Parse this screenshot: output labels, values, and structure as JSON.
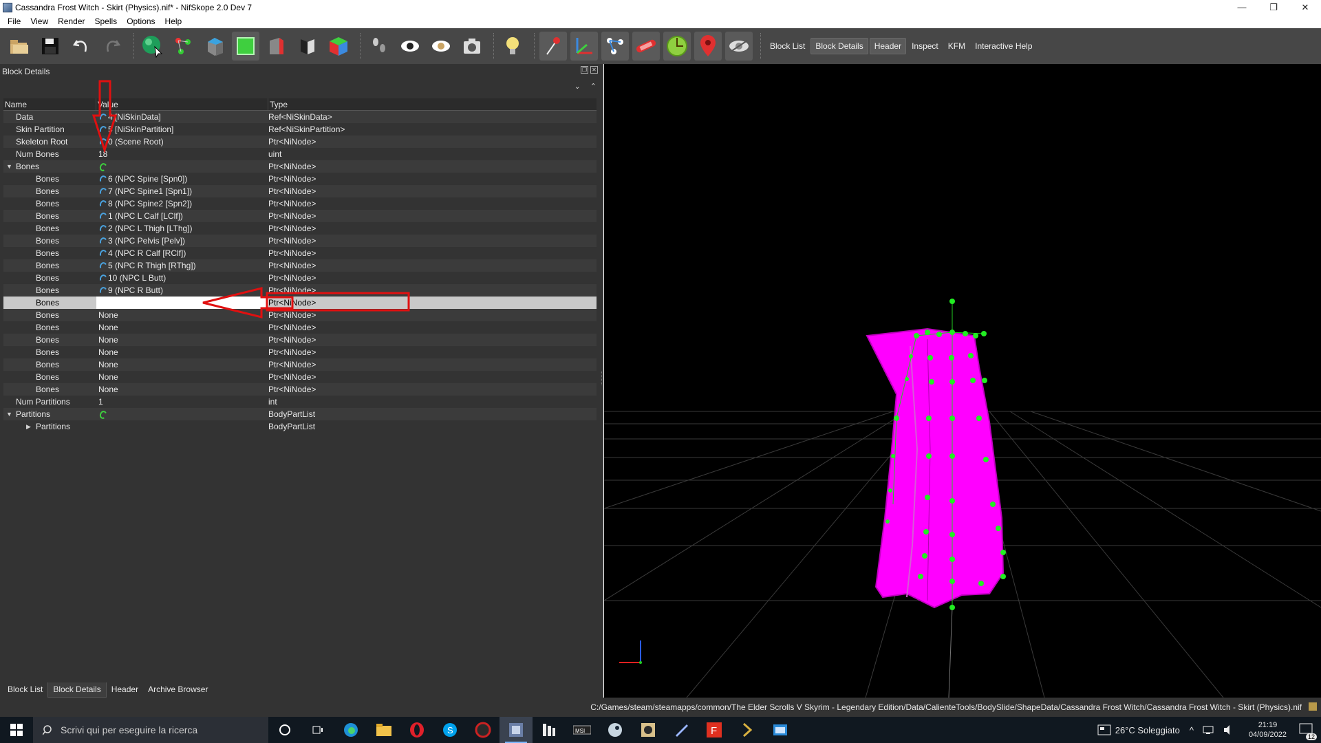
{
  "window": {
    "title": "Cassandra Frost Witch - Skirt (Physics).nif* - NifSkope 2.0 Dev 7",
    "minimize": "—",
    "maximize": "❐",
    "close": "✕"
  },
  "menu": [
    "File",
    "View",
    "Render",
    "Spells",
    "Options",
    "Help"
  ],
  "toolbar": {
    "text_buttons": [
      "Block List",
      "Block Details",
      "Header",
      "Inspect",
      "KFM",
      "Interactive Help"
    ],
    "active_text_button": "Block Details"
  },
  "block_details": {
    "title": "Block Details",
    "columns": [
      "Name",
      "Value",
      "Type"
    ],
    "rows": [
      {
        "name": "Data",
        "value": "4 [NiSkinData]",
        "type": "Ref<NiSkinData>",
        "icon": "link-icon",
        "indent": 1
      },
      {
        "name": "Skin Partition",
        "value": "5 [NiSkinPartition]",
        "type": "Ref<NiSkinPartition>",
        "icon": "link-icon",
        "indent": 1
      },
      {
        "name": "Skeleton Root",
        "value": "0 (Scene Root)",
        "type": "Ptr<NiNode>",
        "icon": "link-icon",
        "indent": 1
      },
      {
        "name": "Num Bones",
        "value": "18",
        "type": "uint",
        "icon": "",
        "indent": 1
      },
      {
        "name": "Bones",
        "value": "",
        "type": "Ptr<NiNode>",
        "icon": "refresh-icon",
        "indent": 1,
        "expanded": true
      },
      {
        "name": "Bones",
        "value": "6 (NPC Spine [Spn0])",
        "type": "Ptr<NiNode>",
        "icon": "link-icon",
        "indent": 2
      },
      {
        "name": "Bones",
        "value": "7 (NPC Spine1 [Spn1])",
        "type": "Ptr<NiNode>",
        "icon": "link-icon",
        "indent": 2
      },
      {
        "name": "Bones",
        "value": "8 (NPC Spine2 [Spn2])",
        "type": "Ptr<NiNode>",
        "icon": "link-icon",
        "indent": 2
      },
      {
        "name": "Bones",
        "value": "1 (NPC L Calf [LClf])",
        "type": "Ptr<NiNode>",
        "icon": "link-icon",
        "indent": 2
      },
      {
        "name": "Bones",
        "value": "2 (NPC L Thigh [LThg])",
        "type": "Ptr<NiNode>",
        "icon": "link-icon",
        "indent": 2
      },
      {
        "name": "Bones",
        "value": "3 (NPC Pelvis [Pelv])",
        "type": "Ptr<NiNode>",
        "icon": "link-icon",
        "indent": 2
      },
      {
        "name": "Bones",
        "value": "4 (NPC R Calf [RClf])",
        "type": "Ptr<NiNode>",
        "icon": "link-icon",
        "indent": 2
      },
      {
        "name": "Bones",
        "value": "5 (NPC R Thigh [RThg])",
        "type": "Ptr<NiNode>",
        "icon": "link-icon",
        "indent": 2
      },
      {
        "name": "Bones",
        "value": "10 (NPC L Butt)",
        "type": "Ptr<NiNode>",
        "icon": "link-icon",
        "indent": 2
      },
      {
        "name": "Bones",
        "value": "9 (NPC R Butt)",
        "type": "Ptr<NiNode>",
        "icon": "link-icon",
        "indent": 2
      },
      {
        "name": "Bones",
        "value": "",
        "type": "Ptr<NiNode>",
        "icon": "",
        "indent": 2,
        "selected": true
      },
      {
        "name": "Bones",
        "value": "None",
        "type": "Ptr<NiNode>",
        "icon": "",
        "indent": 2
      },
      {
        "name": "Bones",
        "value": "None",
        "type": "Ptr<NiNode>",
        "icon": "",
        "indent": 2
      },
      {
        "name": "Bones",
        "value": "None",
        "type": "Ptr<NiNode>",
        "icon": "",
        "indent": 2
      },
      {
        "name": "Bones",
        "value": "None",
        "type": "Ptr<NiNode>",
        "icon": "",
        "indent": 2
      },
      {
        "name": "Bones",
        "value": "None",
        "type": "Ptr<NiNode>",
        "icon": "",
        "indent": 2
      },
      {
        "name": "Bones",
        "value": "None",
        "type": "Ptr<NiNode>",
        "icon": "",
        "indent": 2
      },
      {
        "name": "Bones",
        "value": "None",
        "type": "Ptr<NiNode>",
        "icon": "",
        "indent": 2
      },
      {
        "name": "Num Partitions",
        "value": "1",
        "type": "int",
        "icon": "",
        "indent": 1
      },
      {
        "name": "Partitions",
        "value": "",
        "type": "BodyPartList",
        "icon": "refresh-icon",
        "indent": 1,
        "expanded": true
      },
      {
        "name": "Partitions",
        "value": "",
        "type": "BodyPartList",
        "icon": "",
        "indent": 2,
        "collapsed": true
      }
    ]
  },
  "bottom_tabs": [
    "Block List",
    "Block Details",
    "Header",
    "Archive Browser"
  ],
  "active_bottom_tab": "Block Details",
  "status_path": "C:/Games/steam/steamapps/common/The Elder Scrolls V Skyrim - Legendary Edition/Data/CalienteTools/BodySlide/ShapeData/Cassandra Frost Witch/Cassandra Frost Witch - Skirt (Physics).nif",
  "taskbar": {
    "search_placeholder": "Scrivi qui per eseguire la ricerca",
    "weather": "26°C  Soleggiato",
    "time": "21:19",
    "date": "04/09/2022",
    "notifications": "12"
  },
  "colors": {
    "mesh": "#ff00ff",
    "bone_nodes": "#22ee22",
    "annotation": "#e01010",
    "viewport_bg": "#000000"
  }
}
